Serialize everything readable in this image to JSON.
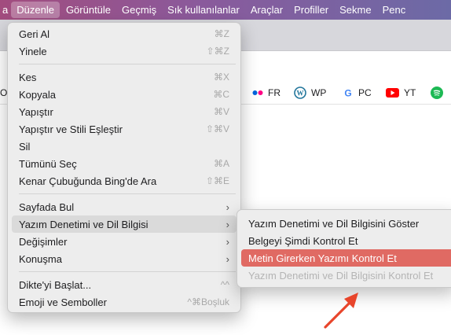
{
  "menubar": {
    "items": [
      "a",
      "Düzenle",
      "Görüntüle",
      "Geçmiş",
      "Sık kullanılanlar",
      "Araçlar",
      "Profiller",
      "Sekme",
      "Penc"
    ]
  },
  "favorites": [
    {
      "icon": "flickr-icon",
      "label": "FR"
    },
    {
      "icon": "wordpress-icon",
      "label": "WP"
    },
    {
      "icon": "google-icon",
      "label": "PC"
    },
    {
      "icon": "youtube-icon",
      "label": "YT"
    },
    {
      "icon": "spotify-icon",
      "label": ""
    }
  ],
  "favbar_clipped": "O",
  "edit_menu": {
    "geri_al": {
      "label": "Geri Al",
      "shortcut": "⌘Z"
    },
    "yinele": {
      "label": "Yinele",
      "shortcut": "⇧⌘Z"
    },
    "kes": {
      "label": "Kes",
      "shortcut": "⌘X"
    },
    "kopyala": {
      "label": "Kopyala",
      "shortcut": "⌘C"
    },
    "yapistir": {
      "label": "Yapıştır",
      "shortcut": "⌘V"
    },
    "yapistir_stil": {
      "label": "Yapıştır ve Stili Eşleştir",
      "shortcut": "⇧⌘V"
    },
    "sil": {
      "label": "Sil"
    },
    "tumunu_sec": {
      "label": "Tümünü Seç",
      "shortcut": "⌘A"
    },
    "bing": {
      "label": "Kenar Çubuğunda Bing'de Ara",
      "shortcut": "⇧⌘E"
    },
    "sayfada_bul": {
      "label": "Sayfada Bul"
    },
    "yazim": {
      "label": "Yazım Denetimi ve Dil Bilgisi"
    },
    "degisimler": {
      "label": "Değişimler"
    },
    "konusma": {
      "label": "Konuşma"
    },
    "dikte": {
      "label": "Dikte'yi Başlat...",
      "shortcut": "^^"
    },
    "emoji": {
      "label": "Emoji ve Semboller",
      "shortcut": "^⌘Boşluk"
    },
    "chevron": "›"
  },
  "submenu": {
    "goster": "Yazım Denetimi ve Dil Bilgisini Göster",
    "kontrol": "Belgeyi Şimdi Kontrol Et",
    "metin": "Metin Girerken Yazımı Kontrol Et",
    "dilbilgisi": "Yazım Denetimi ve Dil Bilgisini Kontrol Et"
  },
  "colors": {
    "highlight": "#e06a63",
    "annotation_arrow": "#e8452b"
  }
}
